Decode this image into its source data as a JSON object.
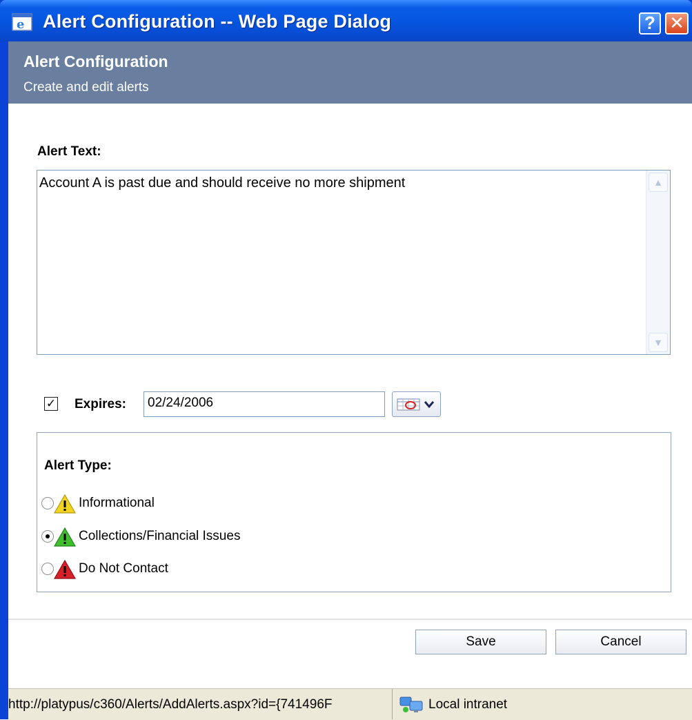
{
  "window": {
    "title": "Alert Configuration -- Web Page Dialog",
    "help_label": "?",
    "close_label": "✕"
  },
  "header": {
    "title": "Alert Configuration",
    "subtitle": "Create and edit alerts"
  },
  "form": {
    "alert_text_label": "Alert Text:",
    "alert_text_value": "Account A is past due and should receive no more shipment",
    "expires_checked": true,
    "expires_check_glyph": "✓",
    "expires_label": "Expires:",
    "expires_value": "02/24/2006",
    "alert_type_label": "Alert Type:",
    "alert_types": [
      {
        "label": "Informational",
        "checked": false,
        "icon": "warning-yellow-icon",
        "color": "#f2d320"
      },
      {
        "label": "Collections/Financial Issues",
        "checked": true,
        "icon": "warning-green-icon",
        "color": "#3fbf2e"
      },
      {
        "label": "Do Not Contact",
        "checked": false,
        "icon": "warning-red-icon",
        "color": "#d8202b"
      }
    ]
  },
  "buttons": {
    "save_label": "Save",
    "cancel_label": "Cancel"
  },
  "statusbar": {
    "url": "http://platypus/c360/Alerts/AddAlerts.aspx?id={741496F",
    "zone": "Local intranet"
  }
}
